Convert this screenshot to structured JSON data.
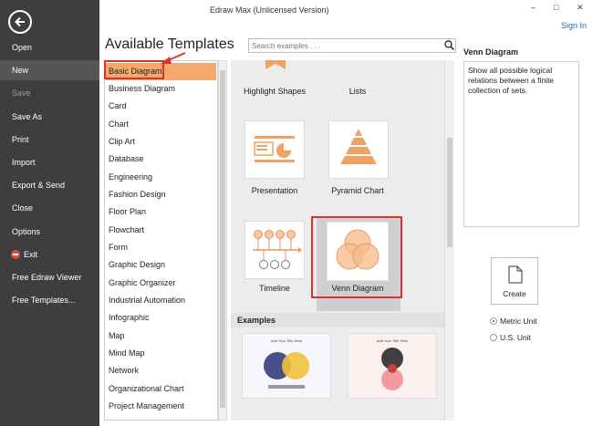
{
  "window": {
    "title": "Edraw Max (Unlicensed Version)",
    "minimize": "–",
    "maximize": "□",
    "close": "✕",
    "sign_in": "Sign In"
  },
  "sidebar": {
    "items": [
      {
        "label": "Open"
      },
      {
        "label": "New",
        "selected": true
      },
      {
        "label": "Save",
        "disabled": true
      },
      {
        "label": "Save As"
      },
      {
        "label": "Print"
      },
      {
        "label": "Import"
      },
      {
        "label": "Export & Send"
      },
      {
        "label": "Close"
      },
      {
        "label": "Options"
      },
      {
        "label": "Exit"
      },
      {
        "label": "Free Edraw Viewer"
      },
      {
        "label": "Free Templates..."
      }
    ]
  },
  "heading": "Available Templates",
  "search": {
    "placeholder": "Search examples . . ."
  },
  "categories": [
    "Basic Diagram",
    "Business Diagram",
    "Card",
    "Chart",
    "Clip Art",
    "Database",
    "Engineering",
    "Fashion Design",
    "Floor Plan",
    "Flowchart",
    "Form",
    "Graphic Design",
    "Graphic Organizer",
    "Industrial Automation",
    "Infographic",
    "Map",
    "Mind Map",
    "Network",
    "Organizational Chart",
    "Project Management"
  ],
  "templates": {
    "highlight": "Highlight Shapes",
    "lists": "Lists",
    "presentation": "Presentation",
    "pyramid": "Pyramid Chart",
    "timeline": "Timeline",
    "venn": "Venn Diagram"
  },
  "examples_label": "Examples",
  "examples": {
    "ex1_title": "Add Your Title Here",
    "ex2_title": "Add Your Title Here"
  },
  "description": {
    "title": "Venn Diagram",
    "text": "Show all possible logical relations between a finite collection of sets."
  },
  "create_label": "Create",
  "units": {
    "metric": "Metric Unit",
    "us": "U.S. Unit"
  },
  "colors": {
    "accent_orange": "#f6a96c",
    "highlight_red": "#d9332f",
    "sidebar_bg": "#3e3e3e"
  }
}
